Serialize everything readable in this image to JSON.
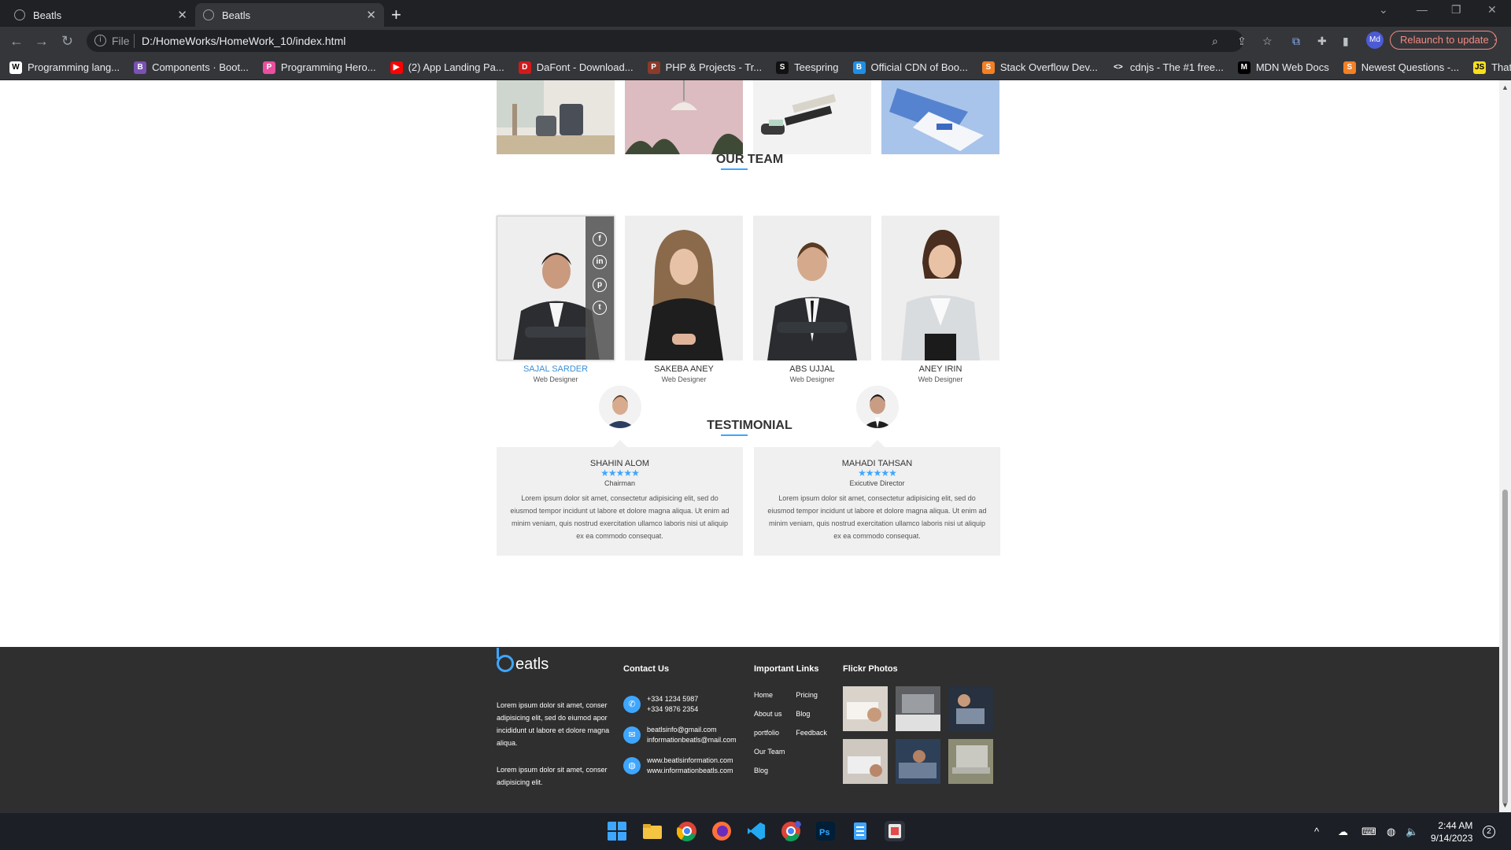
{
  "browser": {
    "tabs": [
      {
        "title": "Beatls"
      },
      {
        "title": "Beatls"
      }
    ],
    "new_tab": "+",
    "window_controls": {
      "minimize": "—",
      "restore": "❐",
      "close": "✕"
    },
    "nav": {
      "back": "←",
      "forward": "→",
      "reload": "↻"
    },
    "scheme": "File",
    "url": "D:/HomeWorks/HomeWork_10/index.html",
    "profile_initials": "Md",
    "relaunch_label": "Relaunch to update",
    "bookmarks": [
      {
        "label": "Programming lang...",
        "icon": "W",
        "color": "#ffffff"
      },
      {
        "label": "Components · Boot...",
        "icon": "B",
        "color": "#7952b3"
      },
      {
        "label": "Programming Hero...",
        "icon": "P",
        "color": "#e94f9f"
      },
      {
        "label": "(2) App Landing Pa...",
        "icon": "▶",
        "color": "#ff0000"
      },
      {
        "label": "DaFont - Download...",
        "icon": "D",
        "color": "#d11a1a"
      },
      {
        "label": "PHP & Projects - Tr...",
        "icon": "P",
        "color": "#8b3a2b"
      },
      {
        "label": "Teespring",
        "icon": "S",
        "color": "#111111"
      },
      {
        "label": "Official CDN of Boo...",
        "icon": "B",
        "color": "#1f8fe5"
      },
      {
        "label": "Stack Overflow Dev...",
        "icon": "S",
        "color": "#f48024"
      },
      {
        "label": "cdnjs - The #1 free...",
        "icon": "<>",
        "color": "#35363a"
      },
      {
        "label": "MDN Web Docs",
        "icon": "M",
        "color": "#000000"
      },
      {
        "label": "Newest Questions -...",
        "icon": "S",
        "color": "#f48024"
      },
      {
        "label": "That JS Dude",
        "icon": "JS",
        "color": "#f7df1e"
      }
    ]
  },
  "team": {
    "title": "OUR TEAM",
    "members": [
      {
        "name": "SAJAL SARDER",
        "role": "Web Designer"
      },
      {
        "name": "SAKEBA ANEY",
        "role": "Web Designer"
      },
      {
        "name": "ABS UJJAL",
        "role": "Web Designer"
      },
      {
        "name": "ANEY IRIN",
        "role": "Web Designer"
      }
    ],
    "social_icons": [
      "facebook-icon",
      "linkedin-icon",
      "pinterest-icon",
      "twitter-icon"
    ],
    "social_glyphs": [
      "f",
      "in",
      "p",
      "t"
    ]
  },
  "testimonial": {
    "title": "TESTIMONIAL",
    "items": [
      {
        "name": "SHAHIN ALOM",
        "stars": "★★★★★",
        "title": "Chairman",
        "text": "Lorem ipsum dolor sit amet, consectetur adipisicing elit, sed do eiusmod tempor incidunt ut labore et dolore magna aliqua. Ut enim ad minim veniam, quis nostrud exercitation ullamco laboris nisi ut aliquip ex ea commodo consequat."
      },
      {
        "name": "MAHADI TAHSAN",
        "stars": "★★★★★",
        "title": "Exicutive Director",
        "text": "Lorem ipsum dolor sit amet, consectetur adipisicing elit, sed do eiusmod tempor incidunt ut labore et dolore magna aliqua. Ut enim ad minim veniam, quis nostrud exercitation ullamco laboris nisi ut aliquip ex ea commodo consequat."
      }
    ]
  },
  "footer": {
    "logo_text": "eatls",
    "about": [
      "Lorem ipsum dolor sit amet, conser adipisicing elit, sed do eiumod apor incididunt ut labore et dolore magna aliqua.",
      "Lorem ipsum dolor sit amet, conser adipisicing elit."
    ],
    "contact_title": "Contact Us",
    "contact": {
      "phones": [
        "+334 1234 5987",
        "+334 9876 2354"
      ],
      "emails": [
        "beatlsinfo@gmail.com",
        "informationbeatls@mail.com"
      ],
      "webs": [
        "www.beatlsinformation.com",
        "www.informationbeatls.com"
      ]
    },
    "links_title": "Important Links",
    "links_col1": [
      "Home",
      "About us",
      "portfolio",
      "Our Team",
      "Blog"
    ],
    "links_col2": [
      "Pricing",
      "Blog",
      "Feedback"
    ],
    "flickr_title": "Flickr Photos"
  },
  "taskbar": {
    "time": "2:44 AM",
    "date": "9/14/2023",
    "notifications": "2"
  },
  "colors": {
    "accent": "#3ea6ff",
    "footer_bg": "#2f2f2f",
    "chrome_bg": "#35363a"
  }
}
